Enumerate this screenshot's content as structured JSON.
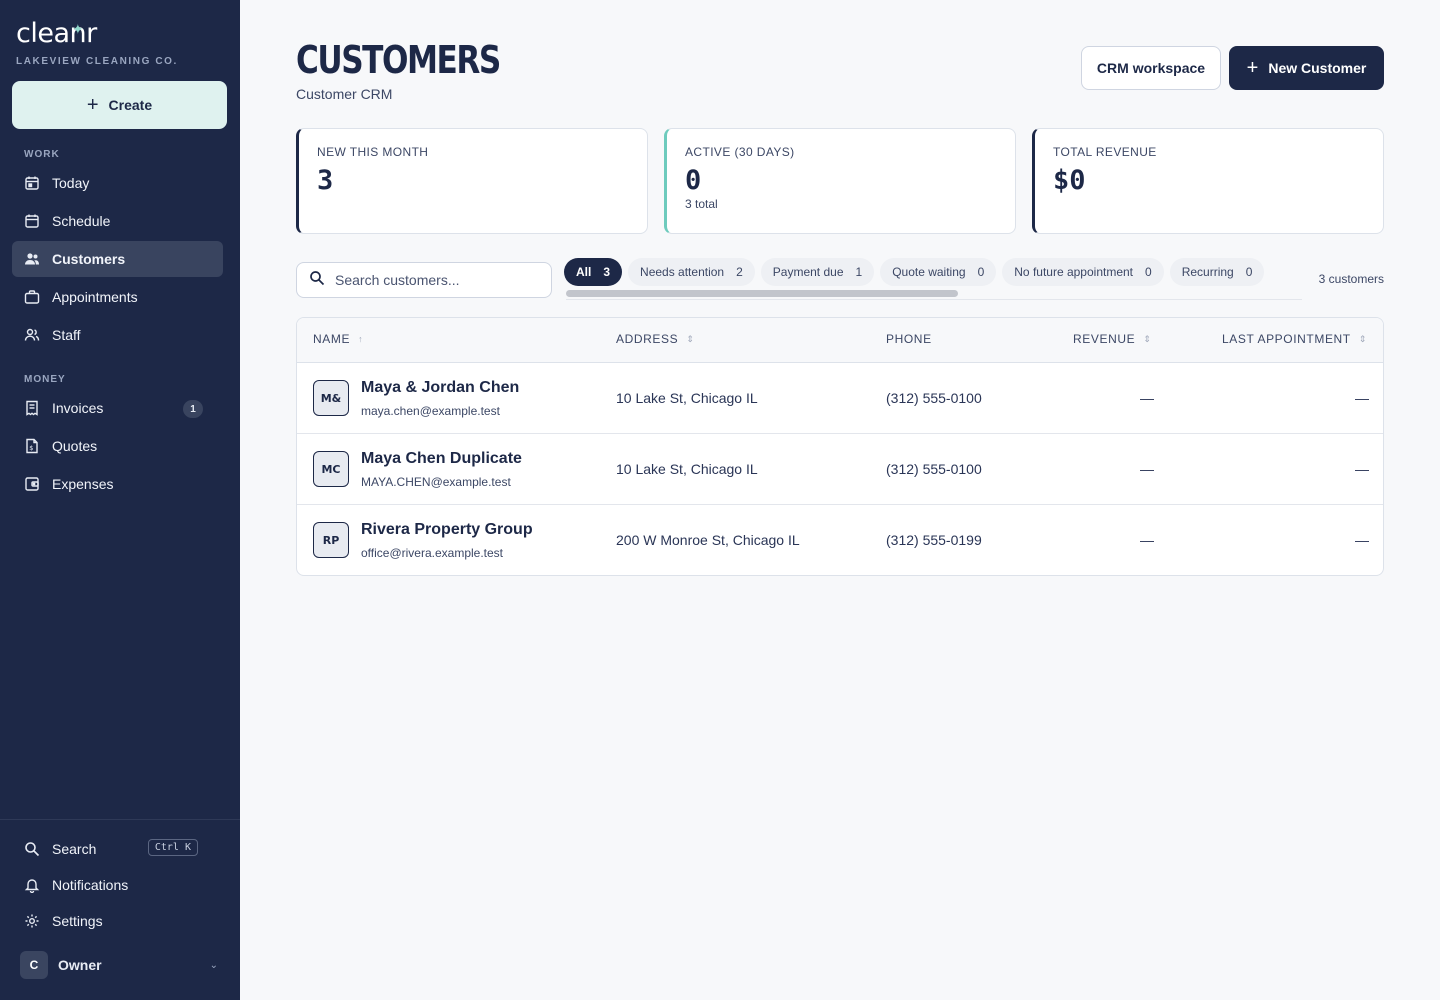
{
  "brand": {
    "logo": "cleanr",
    "org": "LAKEVIEW CLEANING CO."
  },
  "sidebar": {
    "create_label": "Create",
    "sections": {
      "work": "WORK",
      "money": "MONEY"
    },
    "work_items": [
      {
        "label": "Today",
        "icon": "calendar-today-icon"
      },
      {
        "label": "Schedule",
        "icon": "calendar-icon"
      },
      {
        "label": "Customers",
        "icon": "users-icon",
        "active": true
      },
      {
        "label": "Appointments",
        "icon": "briefcase-icon"
      },
      {
        "label": "Staff",
        "icon": "staff-icon"
      }
    ],
    "money_items": [
      {
        "label": "Invoices",
        "icon": "invoice-icon",
        "badge": "1"
      },
      {
        "label": "Quotes",
        "icon": "quote-icon"
      },
      {
        "label": "Expenses",
        "icon": "wallet-icon"
      }
    ],
    "bottom": {
      "search": "Search",
      "search_shortcut": "Ctrl K",
      "notifications": "Notifications",
      "settings": "Settings"
    },
    "owner": {
      "initial": "C",
      "name": "Owner"
    }
  },
  "header": {
    "title": "CUSTOMERS",
    "subtitle": "Customer CRM",
    "crm_button": "CRM workspace",
    "new_button": "New Customer"
  },
  "stats": [
    {
      "label": "NEW THIS MONTH",
      "value": "3",
      "sub": ""
    },
    {
      "label": "ACTIVE (30 DAYS)",
      "value": "0",
      "sub": "3 total"
    },
    {
      "label": "TOTAL REVENUE",
      "value": "$0",
      "sub": ""
    }
  ],
  "search": {
    "placeholder": "Search customers..."
  },
  "filters": [
    {
      "label": "All",
      "count": "3",
      "active": true
    },
    {
      "label": "Needs attention",
      "count": "2"
    },
    {
      "label": "Payment due",
      "count": "1"
    },
    {
      "label": "Quote waiting",
      "count": "0"
    },
    {
      "label": "No future appointment",
      "count": "0"
    },
    {
      "label": "Recurring",
      "count": "0"
    }
  ],
  "customer_count": "3 customers",
  "table": {
    "columns": {
      "name": "NAME",
      "address": "ADDRESS",
      "phone": "PHONE",
      "revenue": "REVENUE",
      "last_appointment": "LAST APPOINTMENT"
    },
    "rows": [
      {
        "initials": "M&",
        "name": "Maya & Jordan Chen",
        "email": "maya.chen@example.test",
        "address": "10 Lake St, Chicago IL",
        "phone": "(312) 555-0100",
        "revenue": "—",
        "last_appointment": "—"
      },
      {
        "initials": "MC",
        "name": "Maya Chen Duplicate",
        "email": "MAYA.CHEN@example.test",
        "address": "10 Lake St, Chicago IL",
        "phone": "(312) 555-0100",
        "revenue": "—",
        "last_appointment": "—"
      },
      {
        "initials": "RP",
        "name": "Rivera Property Group",
        "email": "office@rivera.example.test",
        "address": "200 W Monroe St, Chicago IL",
        "phone": "(312) 555-0199",
        "revenue": "—",
        "last_appointment": "—"
      }
    ]
  },
  "colors": {
    "navy": "#1d2847",
    "teal": "#6ecbbd",
    "mint": "#dff2ef"
  }
}
